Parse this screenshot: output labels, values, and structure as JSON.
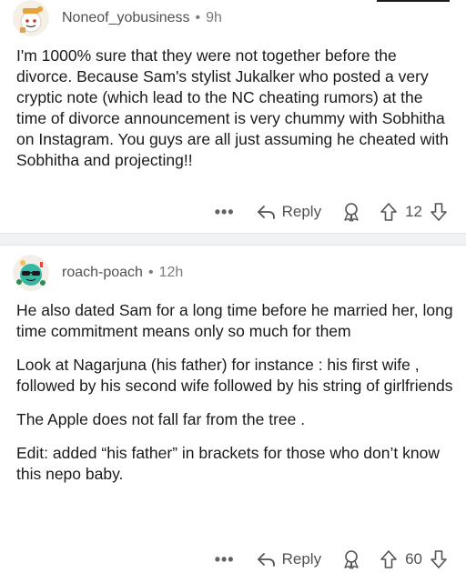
{
  "comments": [
    {
      "username": "Noneof_yobusiness",
      "separator": "•",
      "time": "9h",
      "avatar_icon": "snoo-avatar-icon",
      "paragraphs": [
        "I'm 1000% sure that they were not together before the divorce. Because Sam's stylist Jukalker who posted a very cryptic note (which lead to the NC cheating rumors) at the time of divorce announcement is very chummy with Sobhitha on Instagram. You guys are all just assuming he cheated with Sobhitha and projecting!!"
      ],
      "more_label": "•••",
      "reply_label": "Reply",
      "vote_count": "12"
    },
    {
      "username": "roach-poach",
      "separator": "•",
      "time": "12h",
      "avatar_icon": "snoo-sunglasses-avatar-icon",
      "paragraphs": [
        "He also dated Sam for a long time before he married her, long time commitment means only so much for them",
        "Look at Nagarjuna (his father) for instance : his first wife , followed by his second wife followed by his string of girlfriends",
        "The Apple does not fall far from the tree .",
        "Edit: added “his father” in brackets for those who don’t know this nepo baby."
      ],
      "more_label": "•••",
      "reply_label": "Reply",
      "vote_count": "60"
    }
  ],
  "colors": {
    "text": "#1a1a1b",
    "meta": "#7c7c7c",
    "divider": "#f0f1f2",
    "action": "#505255"
  }
}
